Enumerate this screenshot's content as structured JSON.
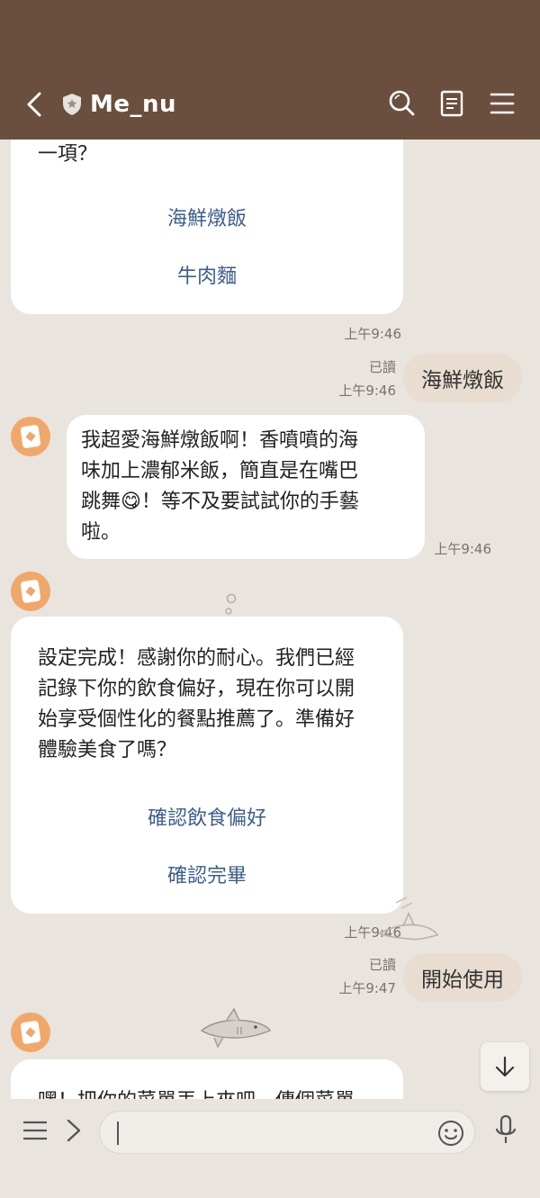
{
  "header": {
    "title": "Me_nu"
  },
  "icons": {
    "back": "chevron-left-icon",
    "badge": "shield-icon",
    "search": "search-icon",
    "notes": "notes-icon",
    "menu": "hamburger-menu-icon",
    "scroll_down": "arrow-down-icon",
    "more": "more-menu-icon",
    "expand": "chevron-right-icon",
    "emoji": "emoji-icon",
    "mic": "microphone-icon"
  },
  "messages": {
    "card1": {
      "text_tail": "一項？",
      "buttons": [
        "海鮮燉飯",
        "牛肉麵"
      ],
      "time": "上午9:46"
    },
    "user1": {
      "read": "已讀",
      "time": "上午9:46",
      "text": "海鮮燉飯"
    },
    "bot1": {
      "lines": [
        "我超愛海鮮燉飯啊！香噴噴的海",
        "味加上濃郁米飯，簡直是在嘴巴",
        "跳舞😋！等不及要試試你的手藝",
        "啦。"
      ],
      "time": "上午9:46"
    },
    "card2": {
      "lines": [
        "設定完成！感謝你的耐心。我們已經",
        "記錄下你的飲食偏好，現在你可以開",
        "始享受個性化的餐點推薦了。準備好",
        "體驗美食了嗎？"
      ],
      "buttons": [
        "確認飲食偏好",
        "確認完畢"
      ],
      "time": "上午9:46"
    },
    "user2": {
      "read": "已讀",
      "time": "上午9:47",
      "text": "開始使用"
    },
    "card3": {
      "partial_text": "嘿！把你的菜單丟上來吧，傳個菜單"
    }
  },
  "input": {
    "placeholder": ""
  },
  "colors": {
    "header_bg": "#6b4f3e",
    "chat_bg": "#e9e4dd",
    "link": "#3d5e8c",
    "user_bubble": "#e8ddd0",
    "avatar": "#f0a86a"
  }
}
